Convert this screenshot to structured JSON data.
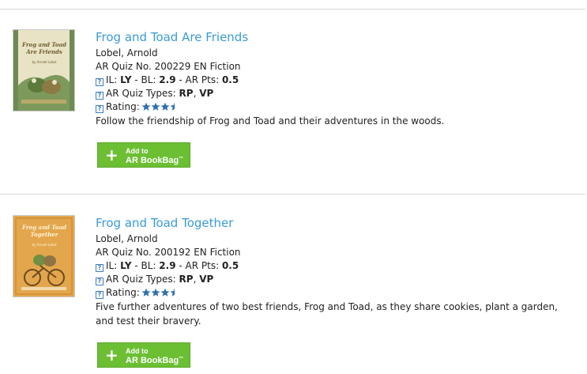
{
  "results": [
    {
      "title": "Frog and Toad Are Friends",
      "author": "Lobel, Arnold",
      "quiz": "AR Quiz No. 200229 EN Fiction",
      "il_label": "IL: ",
      "il": "LY",
      "bl_label": " - BL: ",
      "bl": "2.9",
      "pts_label": " - AR Pts: ",
      "pts": "0.5",
      "quiz_types_label": "AR Quiz Types: ",
      "quiz_type_1": "RP",
      "quiz_type_sep": ", ",
      "quiz_type_2": "VP",
      "rating_label": "Rating:",
      "rating": 3.5,
      "description": "Follow the friendship of Frog and Toad and their adventures in the woods.",
      "cover_title": "Frog and Toad Are Friends",
      "cover_author": "by Arnold Lobel",
      "cover_color": "#e9e3c6",
      "button_line1": "Add to",
      "button_line2": "AR BookBag",
      "button_tm": "™"
    },
    {
      "title": "Frog and Toad Together",
      "author": "Lobel, Arnold",
      "quiz": "AR Quiz No. 200192 EN Fiction",
      "il_label": "IL: ",
      "il": "LY",
      "bl_label": " - BL: ",
      "bl": "2.9",
      "pts_label": " - AR Pts: ",
      "pts": "0.5",
      "quiz_types_label": "AR Quiz Types: ",
      "quiz_type_1": "RP",
      "quiz_type_sep": ", ",
      "quiz_type_2": "VP",
      "rating_label": "Rating:",
      "rating": 3.5,
      "description": "Five further adventures of two best friends, Frog and Toad, as they share cookies, plant a garden, and test their bravery.",
      "cover_title": "Frog and Toad Together",
      "cover_author": "by Arnold Lobel",
      "cover_color": "#e3a64c",
      "button_line1": "Add to",
      "button_line2": "AR BookBag",
      "button_tm": "™"
    }
  ],
  "colors": {
    "title_link": "#3a9bd6",
    "button_green": "#6cbf33",
    "star_blue": "#2f6fb0",
    "divider": "#d6d6d6"
  },
  "icons": {
    "help": "question-mark-box-icon",
    "add": "plus-icon",
    "star": "star-icon"
  }
}
